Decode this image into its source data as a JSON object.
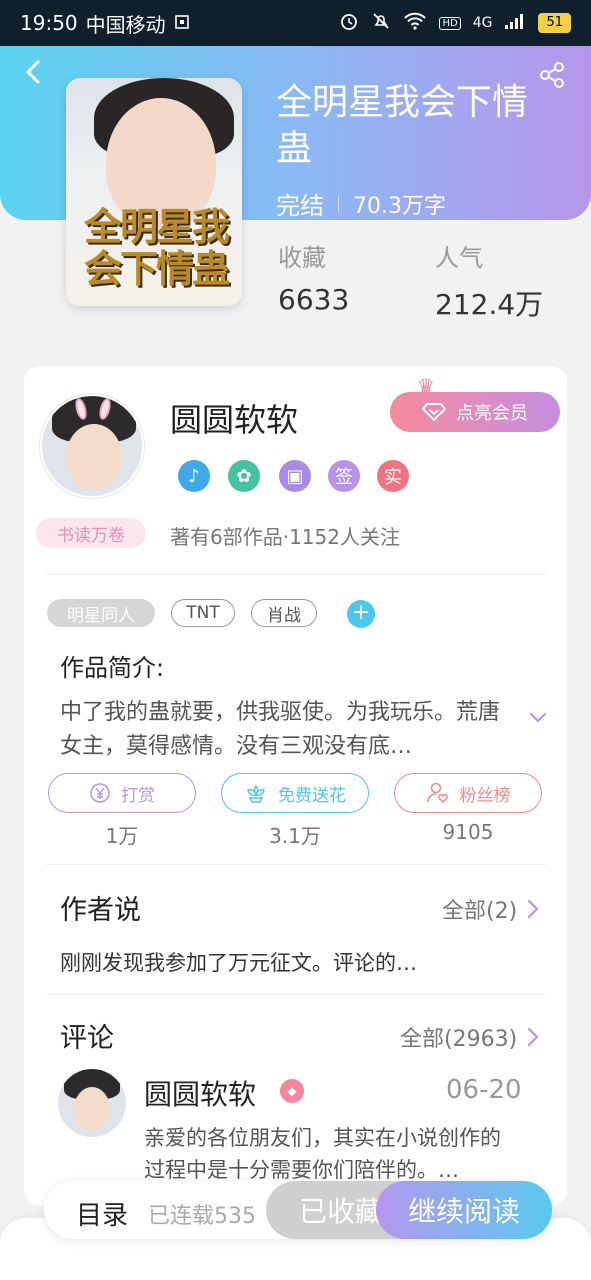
{
  "status_bar": {
    "time": "19:50",
    "carrier": "中国移动",
    "network": "4G",
    "hd": "HD",
    "battery": "51"
  },
  "book": {
    "title": "全明星我会下情蛊",
    "cover_title": "全明星我会下情蛊",
    "status": "完结",
    "word_count": "70.3万字",
    "favorites_label": "收藏",
    "favorites_value": "6633",
    "popularity_label": "人气",
    "popularity_value": "212.4万"
  },
  "author": {
    "name": "圆圆软软",
    "vip_label": "点亮会员",
    "read_tag": "书读万卷",
    "works_info": "著有6部作品·1152人关注",
    "badges": [
      {
        "text": "",
        "color": "#3fa9e8"
      },
      {
        "text": "",
        "color": "#43c3a0"
      },
      {
        "text": "",
        "color": "#a98be6"
      },
      {
        "text": "签",
        "color": "#b993e8"
      },
      {
        "text": "实",
        "color": "#f2737f"
      }
    ]
  },
  "tags": [
    "明星同人",
    "TNT",
    "肖战"
  ],
  "intro": {
    "label": "作品简介:",
    "text": "中了我的蛊就要，供我驱使。为我玩乐。荒唐女主，莫得感情。没有三观没有底…"
  },
  "actions": [
    {
      "label": "打赏",
      "count": "1万",
      "color": "#b993e8"
    },
    {
      "label": "免费送花",
      "count": "3.1万",
      "color": "#4cc7ee"
    },
    {
      "label": "粉丝榜",
      "count": "9105",
      "color": "#f28a8a"
    }
  ],
  "author_say": {
    "title": "作者说",
    "link": "全部(2)",
    "text": "刚刚发现我参加了万元征文。评论的…"
  },
  "comments": {
    "title": "评论",
    "link": "全部(2963)",
    "item": {
      "name": "圆圆软软",
      "date": "06-20",
      "text": "亲爱的各位朋友们，其实在小说创作的过程中是十分需要你们陪伴的。…"
    }
  },
  "bottom": {
    "toc": "目录",
    "serial": "已连载535",
    "collected": "已收藏",
    "continue": "继续阅读"
  },
  "colors": {
    "header_gradient_start": "#5ad3ef",
    "header_gradient_end": "#b796ea",
    "accent_blue": "#4cc7ee",
    "accent_purple": "#b497ee"
  }
}
